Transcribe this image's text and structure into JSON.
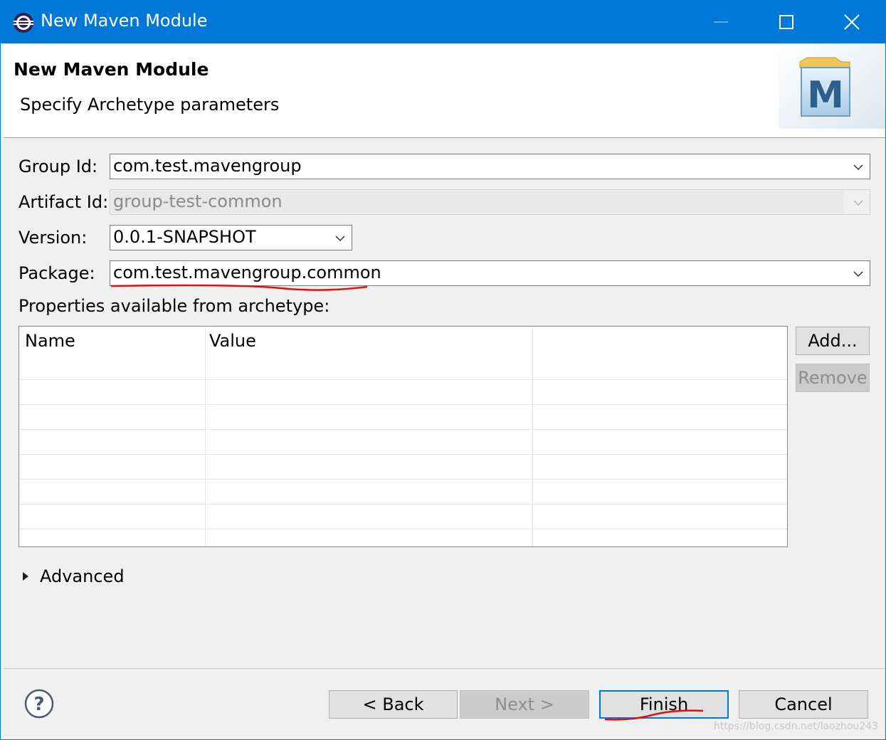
{
  "window": {
    "title": "New Maven Module",
    "accent": "#0078d7"
  },
  "header": {
    "title": "New Maven Module",
    "subtitle": "Specify Archetype parameters",
    "logo_letter": "M"
  },
  "form": {
    "group_id_label": "Group Id:",
    "group_id_value": "com.test.mavengroup",
    "artifact_id_label": "Artifact Id:",
    "artifact_id_value": "group-test-common",
    "version_label": "Version:",
    "version_value": "0.0.1-SNAPSHOT",
    "package_label": "Package:",
    "package_value": "com.test.mavengroup.common",
    "properties_label": "Properties available from archetype:"
  },
  "table": {
    "columns": [
      "Name",
      "Value"
    ]
  },
  "side_buttons": {
    "add": "Add...",
    "remove": "Remove"
  },
  "advanced": {
    "label": "Advanced"
  },
  "footer": {
    "back": "< Back",
    "next": "Next >",
    "finish": "Finish",
    "cancel": "Cancel"
  },
  "watermark": "https://blog.csdn.net/laozhou243",
  "icons": [
    "eclipse-app-icon",
    "minimize-icon",
    "maximize-icon",
    "close-icon",
    "maven-logo-icon",
    "chevron-down-icon",
    "expand-triangle-icon",
    "help-icon"
  ]
}
